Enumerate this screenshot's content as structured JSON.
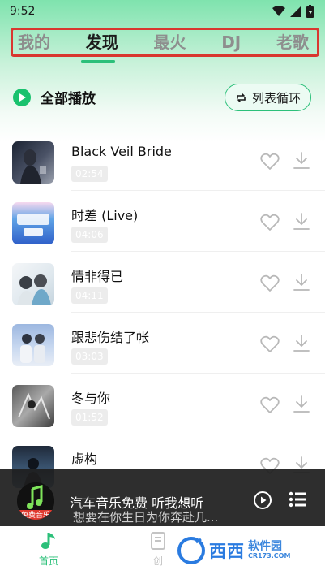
{
  "status_bar": {
    "time": "9:52"
  },
  "tabs": [
    {
      "label": "我的",
      "active": false
    },
    {
      "label": "发现",
      "active": true
    },
    {
      "label": "最火",
      "active": false
    },
    {
      "label": "DJ",
      "active": false
    },
    {
      "label": "老歌",
      "active": false
    }
  ],
  "controls": {
    "play_all_label": "全部播放",
    "loop_label": "列表循环"
  },
  "songs": [
    {
      "title": "Black Veil Bride",
      "duration": "02:54"
    },
    {
      "title": "时差 (Live)",
      "duration": "04:06"
    },
    {
      "title": "情非得已",
      "duration": "04:11"
    },
    {
      "title": "跟悲伤结了帐",
      "duration": "03:03"
    },
    {
      "title": "冬与你",
      "duration": "01:52"
    },
    {
      "title": "虚构",
      "duration": ""
    }
  ],
  "mini_player": {
    "title": "汽车音乐免费   听我想听",
    "lyric": "想要在你生日为你奔赴几...",
    "cover_badge": "免费音乐"
  },
  "bottom_nav": [
    {
      "label": "首页",
      "active": true
    },
    {
      "label": "创",
      "active": false
    }
  ],
  "watermark": {
    "text": "西西",
    "sub": "软件园",
    "site": "CR173.COM"
  },
  "colors": {
    "accent": "#2cc07a",
    "tab_border": "#d9372f",
    "player_bg": "#1e1e1e"
  }
}
